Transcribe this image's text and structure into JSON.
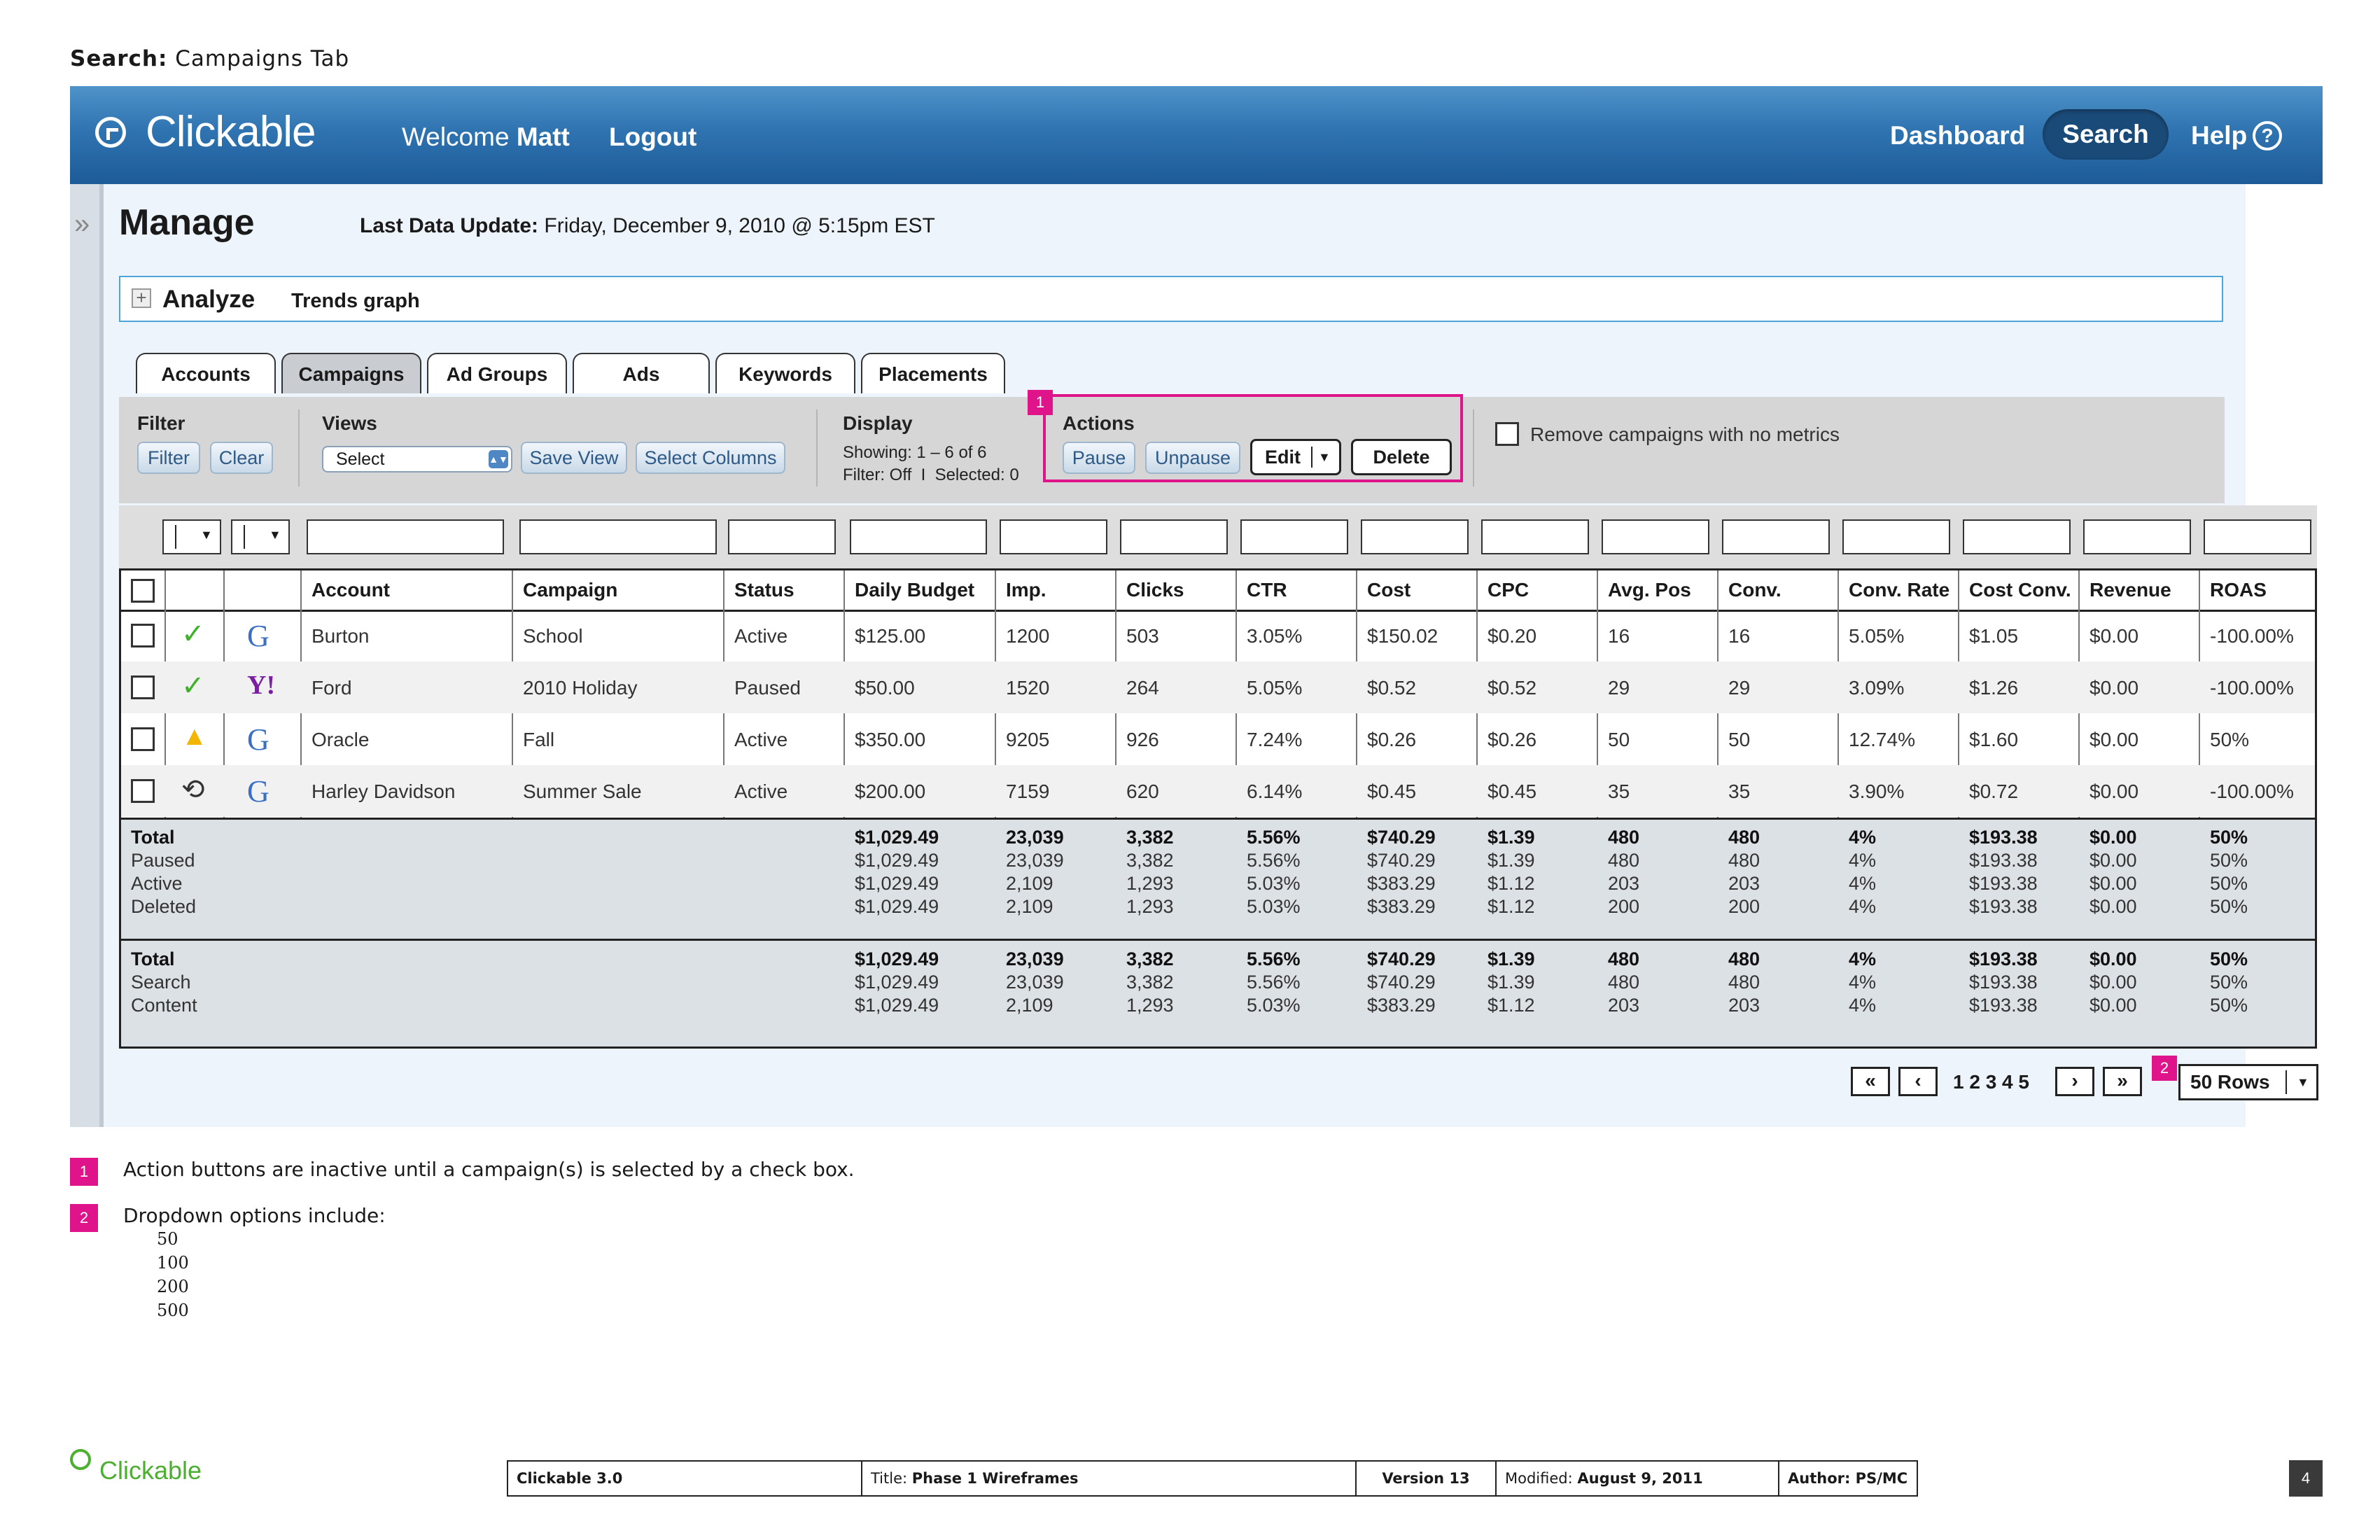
{
  "heading": {
    "prefix": "Search:",
    "text": "Campaigns Tab"
  },
  "header": {
    "logo": "Clickable",
    "welcome_prefix": "Welcome",
    "user": "Matt",
    "logout": "Logout",
    "nav": {
      "dashboard": "Dashboard",
      "search": "Search",
      "help": "Help"
    }
  },
  "manage": {
    "title": "Manage",
    "last_update_label": "Last Data Update:",
    "last_update_value": "Friday, December 9, 2010 @ 5:15pm EST"
  },
  "analyze": {
    "label": "Analyze",
    "link": "Trends graph"
  },
  "tabs": [
    "Accounts",
    "Campaigns",
    "Ad Groups",
    "Ads",
    "Keywords",
    "Placements"
  ],
  "active_tab": "Campaigns",
  "toolbar": {
    "filter_label": "Filter",
    "filter_btn": "Filter",
    "clear_btn": "Clear",
    "views_label": "Views",
    "views_select": "Select",
    "save_view": "Save View",
    "select_columns": "Select Columns",
    "display_label": "Display",
    "showing": "Showing: 1 – 6 of 6",
    "filter_status": "Filter: Off  I  Selected: 0",
    "actions_label": "Actions",
    "pause": "Pause",
    "unpause": "Unpause",
    "edit": "Edit",
    "delete": "Delete",
    "remove_label": "Remove campaigns with no metrics",
    "badge_1": "1"
  },
  "table": {
    "columns": [
      "Account",
      "Campaign",
      "Status",
      "Daily Budget",
      "Imp.",
      "Clicks",
      "CTR",
      "Cost",
      "CPC",
      "Avg. Pos",
      "Conv.",
      "Conv. Rate",
      "Cost Conv.",
      "Revenue",
      "ROAS"
    ],
    "rows": [
      {
        "status_icon": "check-icon",
        "engine": "google-icon",
        "cells": [
          "Burton",
          "School",
          "Active",
          "$125.00",
          "1200",
          "503",
          "3.05%",
          "$150.02",
          "$0.20",
          "16",
          "16",
          "5.05%",
          "$1.05",
          "$0.00",
          "-100.00%"
        ]
      },
      {
        "status_icon": "check-icon",
        "engine": "yahoo-icon",
        "cells": [
          "Ford",
          "2010 Holiday",
          "Paused",
          "$50.00",
          "1520",
          "264",
          "5.05%",
          "$0.52",
          "$0.52",
          "29",
          "29",
          "3.09%",
          "$1.26",
          "$0.00",
          "-100.00%"
        ]
      },
      {
        "status_icon": "warning-icon",
        "engine": "google-icon",
        "cells": [
          "Oracle",
          "Fall",
          "Active",
          "$350.00",
          "9205",
          "926",
          "7.24%",
          "$0.26",
          "$0.26",
          "50",
          "50",
          "12.74%",
          "$1.60",
          "$0.00",
          "50%"
        ]
      },
      {
        "status_icon": "cycle-icon",
        "engine": "google-icon",
        "cells": [
          "Harley Davidson",
          "Summer Sale",
          "Active",
          "$200.00",
          "7159",
          "620",
          "6.14%",
          "$0.45",
          "$0.45",
          "35",
          "35",
          "3.90%",
          "$0.72",
          "$0.00",
          "-100.00%"
        ]
      }
    ],
    "summary1": [
      {
        "label": "Total",
        "bold": true,
        "cells": [
          "$1,029.49",
          "23,039",
          "3,382",
          "5.56%",
          "$740.29",
          "$1.39",
          "480",
          "480",
          "4%",
          "$193.38",
          "$0.00",
          "50%"
        ]
      },
      {
        "label": "Paused",
        "bold": false,
        "cells": [
          "$1,029.49",
          "23,039",
          "3,382",
          "5.56%",
          "$740.29",
          "$1.39",
          "480",
          "480",
          "4%",
          "$193.38",
          "$0.00",
          "50%"
        ]
      },
      {
        "label": "Active",
        "bold": false,
        "cells": [
          "$1,029.49",
          "2,109",
          "1,293",
          "5.03%",
          "$383.29",
          "$1.12",
          "203",
          "203",
          "4%",
          "$193.38",
          "$0.00",
          "50%"
        ]
      },
      {
        "label": "Deleted",
        "bold": false,
        "cells": [
          "$1,029.49",
          "2,109",
          "1,293",
          "5.03%",
          "$383.29",
          "$1.12",
          "200",
          "200",
          "4%",
          "$193.38",
          "$0.00",
          "50%"
        ]
      }
    ],
    "summary2": [
      {
        "label": "Total",
        "bold": true,
        "cells": [
          "$1,029.49",
          "23,039",
          "3,382",
          "5.56%",
          "$740.29",
          "$1.39",
          "480",
          "480",
          "4%",
          "$193.38",
          "$0.00",
          "50%"
        ]
      },
      {
        "label": "Search",
        "bold": false,
        "cells": [
          "$1,029.49",
          "23,039",
          "3,382",
          "5.56%",
          "$740.29",
          "$1.39",
          "480",
          "480",
          "4%",
          "$193.38",
          "$0.00",
          "50%"
        ]
      },
      {
        "label": "Content",
        "bold": false,
        "cells": [
          "$1,029.49",
          "2,109",
          "1,293",
          "5.03%",
          "$383.29",
          "$1.12",
          "203",
          "203",
          "4%",
          "$193.38",
          "$0.00",
          "50%"
        ]
      }
    ]
  },
  "pagination": {
    "first": "«",
    "prev": "‹",
    "pages": "1 2 3 4 5",
    "next": "›",
    "last": "»",
    "rows": "50 Rows",
    "badge_2": "2"
  },
  "notes": [
    {
      "badge": "1",
      "text": "Action buttons are inactive until a campaign(s) is selected by a check box."
    },
    {
      "badge": "2",
      "text": "Dropdown options include:"
    }
  ],
  "dropdown_options": [
    "50",
    "100",
    "200",
    "500"
  ],
  "footer": {
    "logo": "Clickable",
    "product": "Clickable 3.0",
    "title_label": "Title:",
    "title_value": "Phase 1 Wireframes",
    "version": "Version 13",
    "modified_label": "Modified:",
    "modified_value": "August 9, 2011",
    "author": "Author: PS/MC",
    "page": "4"
  }
}
